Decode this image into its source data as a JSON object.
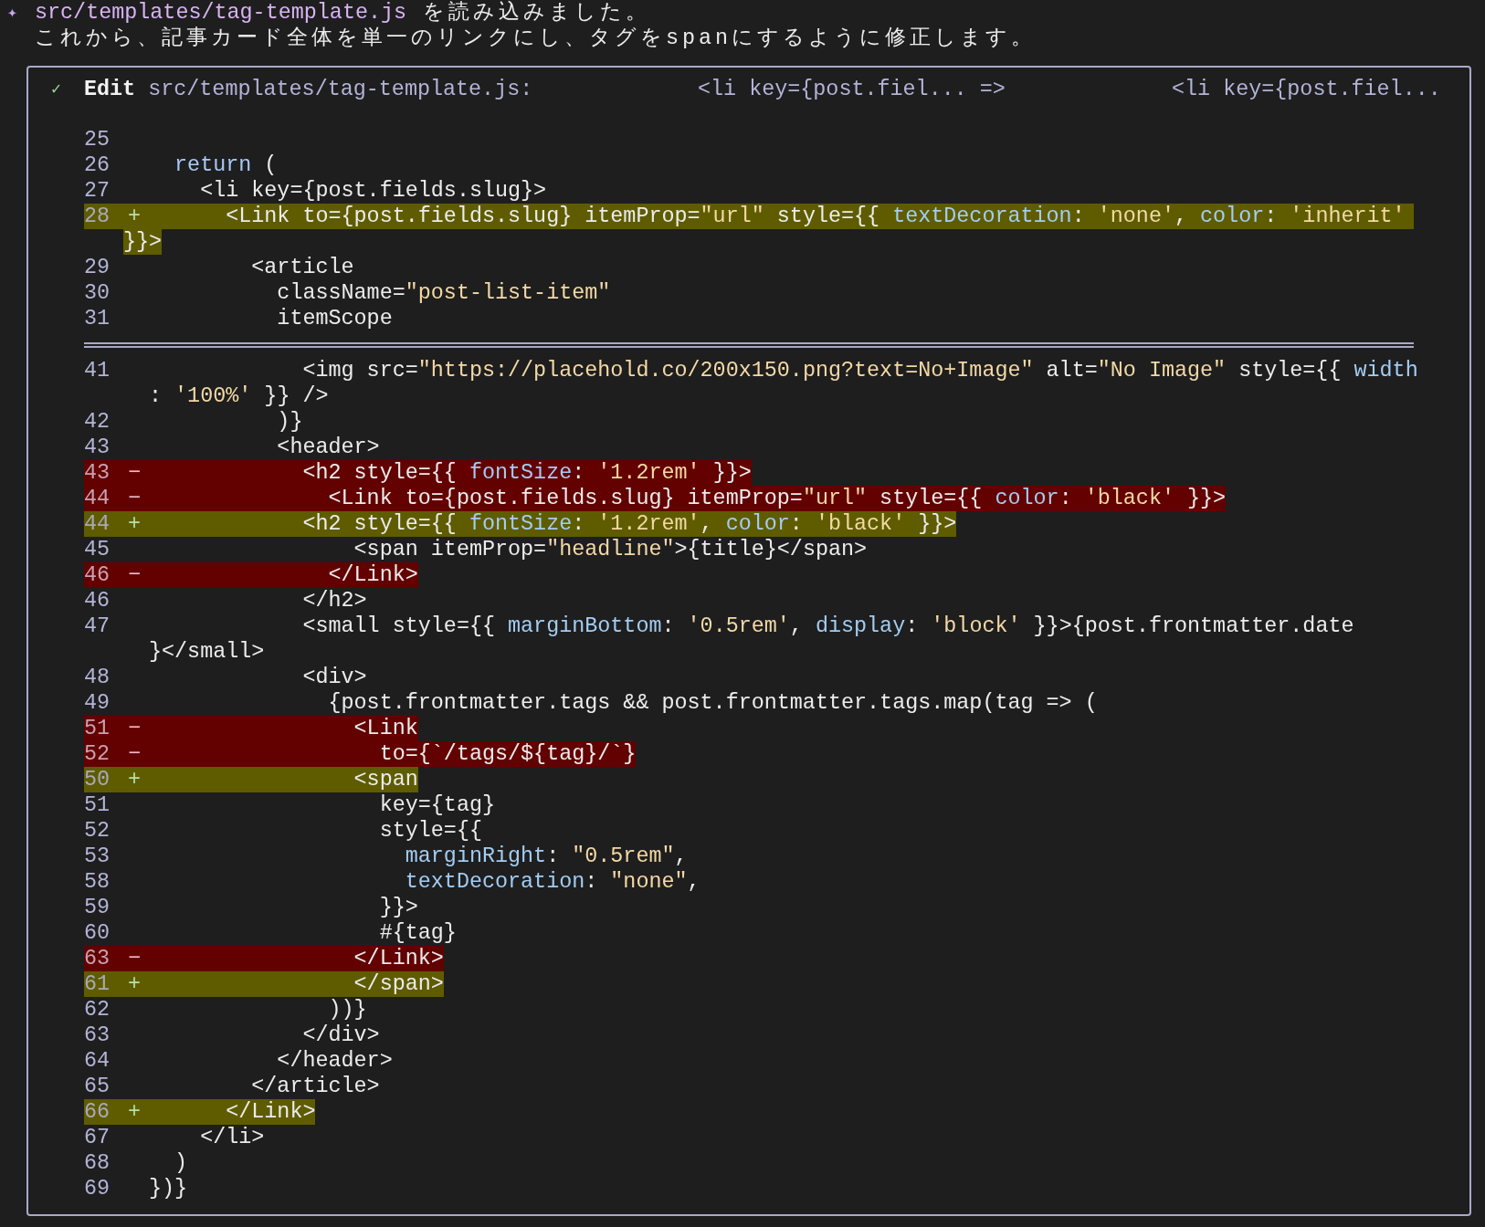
{
  "message": {
    "bullet": "✦",
    "file": "src/templates/tag-template.js",
    "lines": [
      "を読み込みました。",
      "これから、記事カード全体を単一のリンクにし、タグをspanにするように修正します。"
    ]
  },
  "edit": {
    "completed": true,
    "status_icon": "✓",
    "label": "Edit",
    "file": "src/templates/tag-template.js:",
    "old_preview": "<li key={post.fiel... =>",
    "new_preview": "<li key={post.fiel..."
  },
  "hunks": [
    {
      "lines": [
        {
          "number": "25",
          "kind": "context"
        },
        {
          "number": "26",
          "kind": "context",
          "segments": [
            {
              "kind": "keyword",
              "text": "  return"
            },
            {
              "kind": "plain",
              "text": " ("
            }
          ]
        },
        {
          "number": "27",
          "kind": "context",
          "segments": [
            {
              "kind": "plain",
              "text": "    <li key={post.fields.slug}>"
            }
          ]
        },
        {
          "number": "28",
          "kind": "added",
          "marker": "+",
          "segments": [
            {
              "kind": "plain",
              "text": "      <Link to={post.fields.slug} itemProp="
            },
            {
              "kind": "string",
              "text": "\"url\""
            },
            {
              "kind": "plain",
              "text": " style={{ "
            },
            {
              "kind": "prop",
              "text": "textDecoration"
            },
            {
              "kind": "plain",
              "text": ": "
            },
            {
              "kind": "string",
              "text": "'none'"
            },
            {
              "kind": "plain",
              "text": ", "
            },
            {
              "kind": "prop",
              "text": "color"
            },
            {
              "kind": "plain",
              "text": ": "
            },
            {
              "kind": "string",
              "text": "'inherit'"
            }
          ],
          "wrap": [
            {
              "kind": "plain",
              "text": "}}>"
            }
          ]
        },
        {
          "number": "29",
          "kind": "context",
          "segments": [
            {
              "kind": "plain",
              "text": "        <article"
            }
          ]
        },
        {
          "number": "30",
          "kind": "context",
          "segments": [
            {
              "kind": "plain",
              "text": "          className="
            },
            {
              "kind": "string",
              "text": "\"post-list-item\""
            }
          ]
        },
        {
          "number": "31",
          "kind": "context",
          "segments": [
            {
              "kind": "plain",
              "text": "          itemScope"
            }
          ]
        }
      ]
    },
    {
      "lines": [
        {
          "number": "41",
          "kind": "context",
          "segments": [
            {
              "kind": "plain",
              "text": "            <img src="
            },
            {
              "kind": "string",
              "text": "\"https://placehold.co/200x150.png?text=No+Image\""
            },
            {
              "kind": "plain",
              "text": " alt="
            },
            {
              "kind": "string",
              "text": "\"No Image\""
            },
            {
              "kind": "plain",
              "text": " style={{ "
            },
            {
              "kind": "prop",
              "text": "width"
            }
          ],
          "wrap": [
            {
              "kind": "plain",
              "text": ": "
            },
            {
              "kind": "string",
              "text": "'100%'"
            },
            {
              "kind": "plain",
              "text": " }} />"
            }
          ]
        },
        {
          "number": "42",
          "kind": "context",
          "segments": [
            {
              "kind": "plain",
              "text": "          )}"
            }
          ]
        },
        {
          "number": "43",
          "kind": "context",
          "segments": [
            {
              "kind": "plain",
              "text": "          <header>"
            }
          ]
        },
        {
          "number": "43",
          "kind": "removed",
          "marker": "−",
          "segments": [
            {
              "kind": "plain",
              "text": "            <h2 style={{ "
            },
            {
              "kind": "prop",
              "text": "fontSize"
            },
            {
              "kind": "plain",
              "text": ": "
            },
            {
              "kind": "string",
              "text": "'1.2rem'"
            },
            {
              "kind": "plain",
              "text": " }}>"
            }
          ]
        },
        {
          "number": "44",
          "kind": "removed",
          "marker": "−",
          "segments": [
            {
              "kind": "plain",
              "text": "              <Link to={post.fields.slug} itemProp="
            },
            {
              "kind": "string",
              "text": "\"url\""
            },
            {
              "kind": "plain",
              "text": " style={{ "
            },
            {
              "kind": "prop",
              "text": "color"
            },
            {
              "kind": "plain",
              "text": ": "
            },
            {
              "kind": "string",
              "text": "'black'"
            },
            {
              "kind": "plain",
              "text": " }}>"
            }
          ]
        },
        {
          "number": "44",
          "kind": "added",
          "marker": "+",
          "segments": [
            {
              "kind": "plain",
              "text": "            <h2 style={{ "
            },
            {
              "kind": "prop",
              "text": "fontSize"
            },
            {
              "kind": "plain",
              "text": ": "
            },
            {
              "kind": "string",
              "text": "'1.2rem'"
            },
            {
              "kind": "plain",
              "text": ", "
            },
            {
              "kind": "prop",
              "text": "color"
            },
            {
              "kind": "plain",
              "text": ": "
            },
            {
              "kind": "string",
              "text": "'black'"
            },
            {
              "kind": "plain",
              "text": " }}>"
            }
          ]
        },
        {
          "number": "45",
          "kind": "context",
          "segments": [
            {
              "kind": "plain",
              "text": "                <span itemProp="
            },
            {
              "kind": "string",
              "text": "\"headline\""
            },
            {
              "kind": "plain",
              "text": ">{title}</span>"
            }
          ]
        },
        {
          "number": "46",
          "kind": "removed",
          "marker": "−",
          "segments": [
            {
              "kind": "plain",
              "text": "              </Link>"
            }
          ]
        },
        {
          "number": "46",
          "kind": "context",
          "segments": [
            {
              "kind": "plain",
              "text": "            </h2>"
            }
          ]
        },
        {
          "number": "47",
          "kind": "context",
          "segments": [
            {
              "kind": "plain",
              "text": "            <small style={{ "
            },
            {
              "kind": "prop",
              "text": "marginBottom"
            },
            {
              "kind": "plain",
              "text": ": "
            },
            {
              "kind": "string",
              "text": "'0.5rem'"
            },
            {
              "kind": "plain",
              "text": ", "
            },
            {
              "kind": "prop",
              "text": "display"
            },
            {
              "kind": "plain",
              "text": ": "
            },
            {
              "kind": "string",
              "text": "'block'"
            },
            {
              "kind": "plain",
              "text": " }}>{post.frontmatter.date"
            }
          ],
          "wrap": [
            {
              "kind": "plain",
              "text": "}</small>"
            }
          ]
        },
        {
          "number": "48",
          "kind": "context",
          "segments": [
            {
              "kind": "plain",
              "text": "            <div>"
            }
          ]
        },
        {
          "number": "49",
          "kind": "context",
          "segments": [
            {
              "kind": "plain",
              "text": "              {post.frontmatter.tags && post.frontmatter.tags.map(tag => ("
            }
          ]
        },
        {
          "number": "51",
          "kind": "removed",
          "marker": "−",
          "segments": [
            {
              "kind": "plain",
              "text": "                <Link"
            }
          ]
        },
        {
          "number": "52",
          "kind": "removed",
          "marker": "−",
          "segments": [
            {
              "kind": "plain",
              "text": "                  to={`/tags/${tag}/`}"
            }
          ]
        },
        {
          "number": "50",
          "kind": "added",
          "marker": "+",
          "segments": [
            {
              "kind": "plain",
              "text": "                <span"
            }
          ]
        },
        {
          "number": "51",
          "kind": "context",
          "segments": [
            {
              "kind": "plain",
              "text": "                  key={tag}"
            }
          ]
        },
        {
          "number": "52",
          "kind": "context",
          "segments": [
            {
              "kind": "plain",
              "text": "                  style={{"
            }
          ]
        },
        {
          "number": "53",
          "kind": "context",
          "segments": [
            {
              "kind": "prop",
              "text": "                    marginRight"
            },
            {
              "kind": "plain",
              "text": ": "
            },
            {
              "kind": "string",
              "text": "\"0.5rem\""
            },
            {
              "kind": "plain",
              "text": ","
            }
          ]
        },
        {
          "number": "58",
          "kind": "context",
          "segments": [
            {
              "kind": "prop",
              "text": "                    textDecoration"
            },
            {
              "kind": "plain",
              "text": ": "
            },
            {
              "kind": "string",
              "text": "\"none\""
            },
            {
              "kind": "plain",
              "text": ","
            }
          ]
        },
        {
          "number": "59",
          "kind": "context",
          "segments": [
            {
              "kind": "plain",
              "text": "                  }}>"
            }
          ]
        },
        {
          "number": "60",
          "kind": "context",
          "segments": [
            {
              "kind": "plain",
              "text": "                  #{tag}"
            }
          ]
        },
        {
          "number": "63",
          "kind": "removed",
          "marker": "−",
          "segments": [
            {
              "kind": "plain",
              "text": "                </Link>"
            }
          ]
        },
        {
          "number": "61",
          "kind": "added",
          "marker": "+",
          "segments": [
            {
              "kind": "plain",
              "text": "                </span>"
            }
          ]
        },
        {
          "number": "62",
          "kind": "context",
          "segments": [
            {
              "kind": "plain",
              "text": "              ))}"
            }
          ]
        },
        {
          "number": "63",
          "kind": "context",
          "segments": [
            {
              "kind": "plain",
              "text": "            </div>"
            }
          ]
        },
        {
          "number": "64",
          "kind": "context",
          "segments": [
            {
              "kind": "plain",
              "text": "          </header>"
            }
          ]
        },
        {
          "number": "65",
          "kind": "context",
          "segments": [
            {
              "kind": "plain",
              "text": "        </article>"
            }
          ]
        },
        {
          "number": "66",
          "kind": "added",
          "marker": "+",
          "segments": [
            {
              "kind": "plain",
              "text": "      </Link>"
            }
          ]
        },
        {
          "number": "67",
          "kind": "context",
          "segments": [
            {
              "kind": "plain",
              "text": "    </li>"
            }
          ]
        },
        {
          "number": "68",
          "kind": "context",
          "segments": [
            {
              "kind": "plain",
              "text": "  )"
            }
          ]
        },
        {
          "number": "69",
          "kind": "context",
          "segments": [
            {
              "kind": "plain",
              "text": "})}"
            }
          ]
        }
      ]
    }
  ]
}
